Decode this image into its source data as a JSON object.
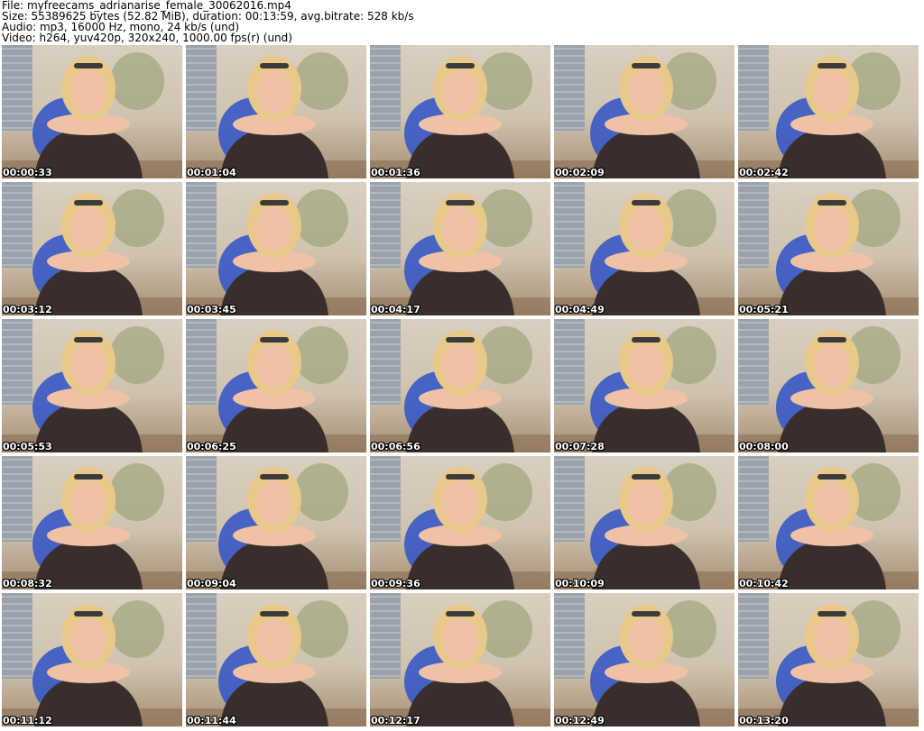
{
  "header": {
    "file_line": "File: myfreecams_adrianarise_female_30062016.mp4",
    "size_line": "Size: 55389625 bytes (52.82 MiB), duration: 00:13:59, avg.bitrate: 528 kb/s",
    "audio_line": "Audio: mp3, 16000 Hz, mono, 24 kb/s (und)",
    "video_line": "Video: h264, yuv420p, 320x240, 1000.00 fps(r) (und)"
  },
  "thumbnails": [
    {
      "timestamp": "00:00:33"
    },
    {
      "timestamp": "00:01:04"
    },
    {
      "timestamp": "00:01:36"
    },
    {
      "timestamp": "00:02:09"
    },
    {
      "timestamp": "00:02:42"
    },
    {
      "timestamp": "00:03:12"
    },
    {
      "timestamp": "00:03:45"
    },
    {
      "timestamp": "00:04:17"
    },
    {
      "timestamp": "00:04:49"
    },
    {
      "timestamp": "00:05:21"
    },
    {
      "timestamp": "00:05:53"
    },
    {
      "timestamp": "00:06:25"
    },
    {
      "timestamp": "00:06:56"
    },
    {
      "timestamp": "00:07:28"
    },
    {
      "timestamp": "00:08:00"
    },
    {
      "timestamp": "00:08:32"
    },
    {
      "timestamp": "00:09:04"
    },
    {
      "timestamp": "00:09:36"
    },
    {
      "timestamp": "00:10:09"
    },
    {
      "timestamp": "00:10:42"
    },
    {
      "timestamp": "00:11:12"
    },
    {
      "timestamp": "00:11:44"
    },
    {
      "timestamp": "00:12:17"
    },
    {
      "timestamp": "00:12:49"
    },
    {
      "timestamp": "00:13:20"
    }
  ],
  "colors": {
    "wall": "#d9cfc0",
    "window": "#9aa2ac",
    "chair": "#2f52c8",
    "hair": "#e8c98a",
    "skin": "#efc2a6",
    "top": "#3a2e2c",
    "floor": "#8a6f55"
  }
}
